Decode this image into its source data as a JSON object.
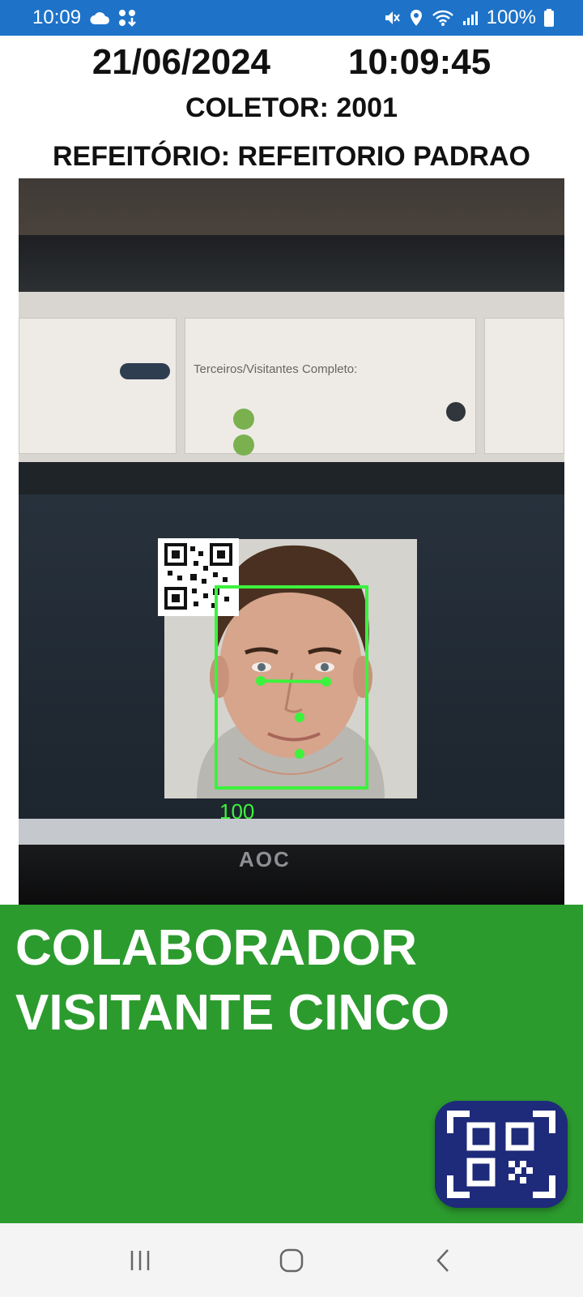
{
  "status_bar": {
    "time": "10:09",
    "battery": "100%",
    "icons": [
      "cloud-icon",
      "network-share-icon",
      "mute-icon",
      "location-icon",
      "wifi-icon",
      "signal-icon",
      "battery-icon"
    ]
  },
  "header": {
    "date": "21/06/2024",
    "time": "10:09:45",
    "collector": "COLETOR: 2001",
    "cafeteria": "REFEITÓRIO: REFEITORIO PADRAO"
  },
  "camera": {
    "panel_title": "Terceiros/Visitantes Completo:",
    "monitor_brand": "AOC",
    "face_score": "100",
    "face_box_color": "#3cf23c"
  },
  "result": {
    "name": "COLABORADOR VISITANTE CINCO",
    "background_color": "#2c9b2e",
    "qr_button_icon": "qr-code-scan-icon"
  },
  "nav_bar": {
    "buttons": [
      "recent-apps-icon",
      "home-icon",
      "back-icon"
    ]
  }
}
